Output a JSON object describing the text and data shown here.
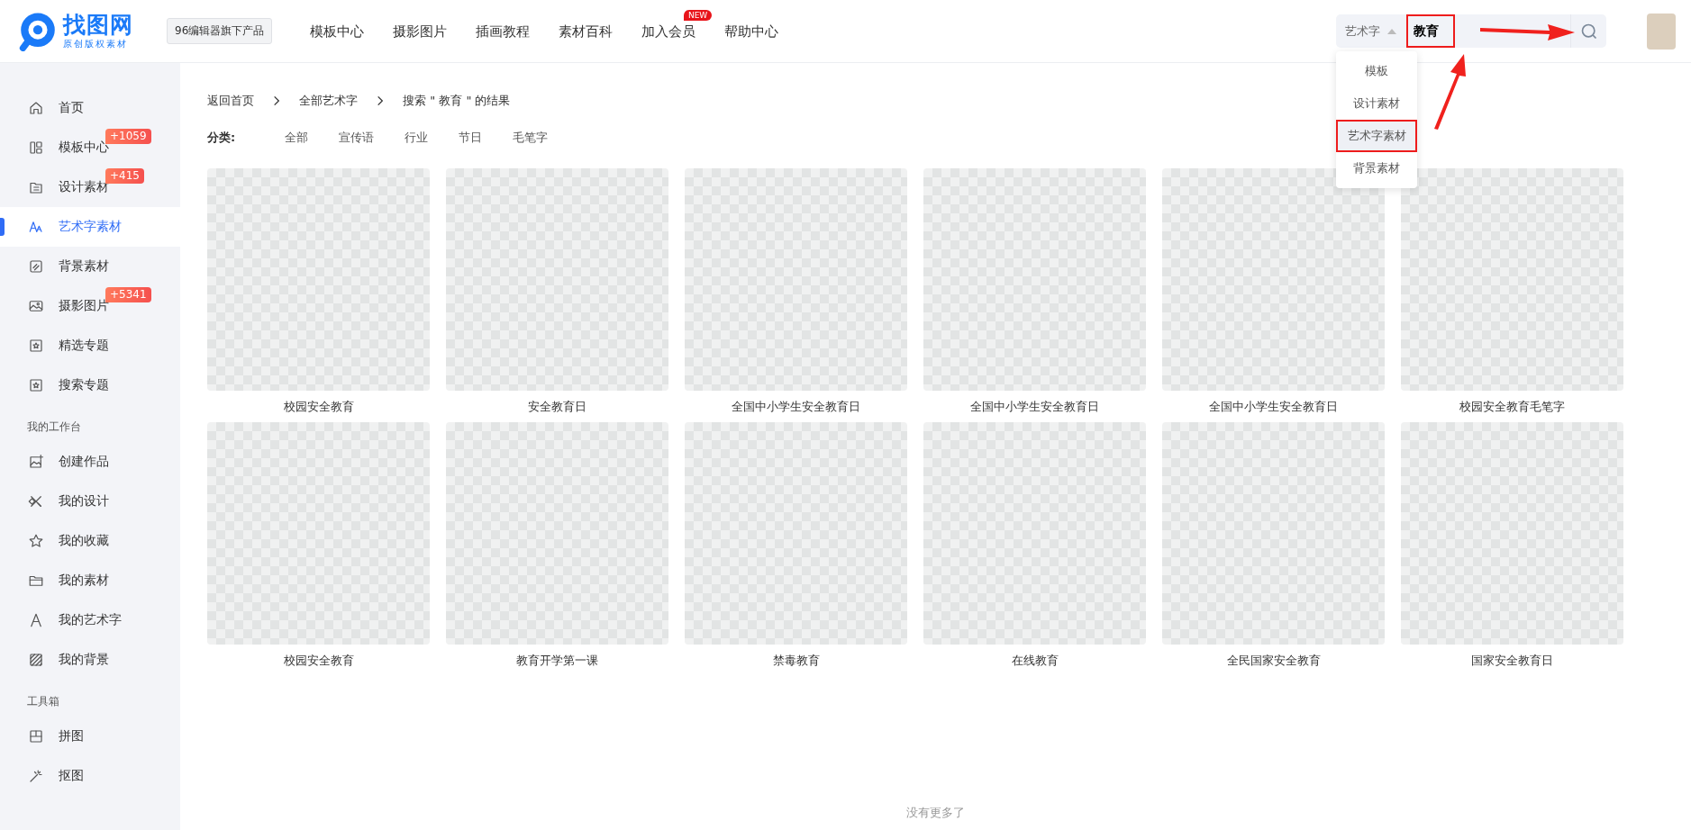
{
  "header": {
    "logo": {
      "name": "找图网",
      "tagline": "原创版权素材"
    },
    "product_badge": "96编辑器旗下产品",
    "nav": [
      {
        "label": "模板中心"
      },
      {
        "label": "摄影图片"
      },
      {
        "label": "插画教程"
      },
      {
        "label": "素材百科"
      },
      {
        "label": "加入会员",
        "badge": "NEW"
      },
      {
        "label": "帮助中心"
      }
    ],
    "search": {
      "scope": "艺术字",
      "value": "教育",
      "highlighted": true,
      "dropdown": [
        {
          "label": "模板",
          "selected": false,
          "highlighted": false
        },
        {
          "label": "设计素材",
          "selected": false,
          "highlighted": false
        },
        {
          "label": "艺术字素材",
          "selected": true,
          "highlighted": true
        },
        {
          "label": "背景素材",
          "selected": false,
          "highlighted": false
        }
      ]
    }
  },
  "sidebar": {
    "sections": [
      {
        "items": [
          {
            "label": "首页",
            "selected": false
          },
          {
            "label": "模板中心",
            "badge": "+1059",
            "selected": false
          },
          {
            "label": "设计素材",
            "badge": "+415",
            "selected": false
          },
          {
            "label": "艺术字素材",
            "selected": true
          },
          {
            "label": "背景素材",
            "selected": false
          },
          {
            "label": "摄影图片",
            "badge": "+5341",
            "selected": false
          },
          {
            "label": "精选专题",
            "selected": false
          },
          {
            "label": "搜索专题",
            "selected": false
          }
        ]
      },
      {
        "title": "我的工作台",
        "items": [
          {
            "label": "创建作品",
            "selected": false
          },
          {
            "label": "我的设计",
            "selected": false
          },
          {
            "label": "我的收藏",
            "selected": false
          },
          {
            "label": "我的素材",
            "selected": false
          },
          {
            "label": "我的艺术字",
            "selected": false
          },
          {
            "label": "我的背景",
            "selected": false
          }
        ]
      },
      {
        "title": "工具箱",
        "items": [
          {
            "label": "拼图",
            "selected": false
          },
          {
            "label": "抠图",
            "selected": false
          }
        ]
      }
    ]
  },
  "breadcrumb": [
    "返回首页",
    "全部艺术字",
    "搜索 \" 教育 \" 的结果"
  ],
  "categories": {
    "label": "分类:",
    "items": [
      "全部",
      "宣传语",
      "行业",
      "节日",
      "毛笔字"
    ]
  },
  "results": [
    {
      "title": "校园安全教育"
    },
    {
      "title": "安全教育日"
    },
    {
      "title": "全国中小学生安全教育日"
    },
    {
      "title": "全国中小学生安全教育日"
    },
    {
      "title": "全国中小学生安全教育日"
    },
    {
      "title": "校园安全教育毛笔字"
    },
    {
      "title": "校园安全教育"
    },
    {
      "title": "教育开学第一课"
    },
    {
      "title": "禁毒教育"
    },
    {
      "title": "在线教育"
    },
    {
      "title": "全民国家安全教育"
    },
    {
      "title": "国家安全教育日"
    }
  ],
  "footer": "没有更多了"
}
